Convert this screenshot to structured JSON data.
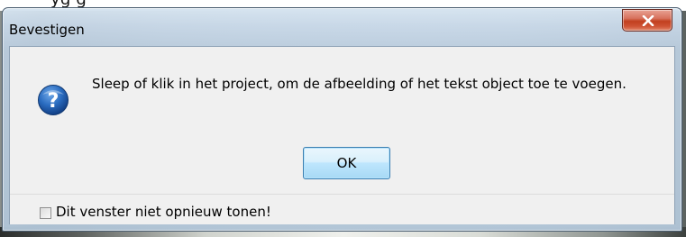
{
  "background": {
    "partial_text": "yg     g"
  },
  "window": {
    "title": "Bevestigen",
    "close_icon": "close-x-icon",
    "message_icon": "question-icon",
    "message": "Sleep of klik in het project, om de afbeelding of het tekst object toe te voegen.",
    "ok_label": "OK",
    "checkbox": {
      "label": "Dit venster niet opnieuw tonen!",
      "checked": false
    }
  },
  "colors": {
    "close_button": "#c7482a",
    "ok_border": "#3c7fb1",
    "question_icon": "#1d5aa6"
  }
}
